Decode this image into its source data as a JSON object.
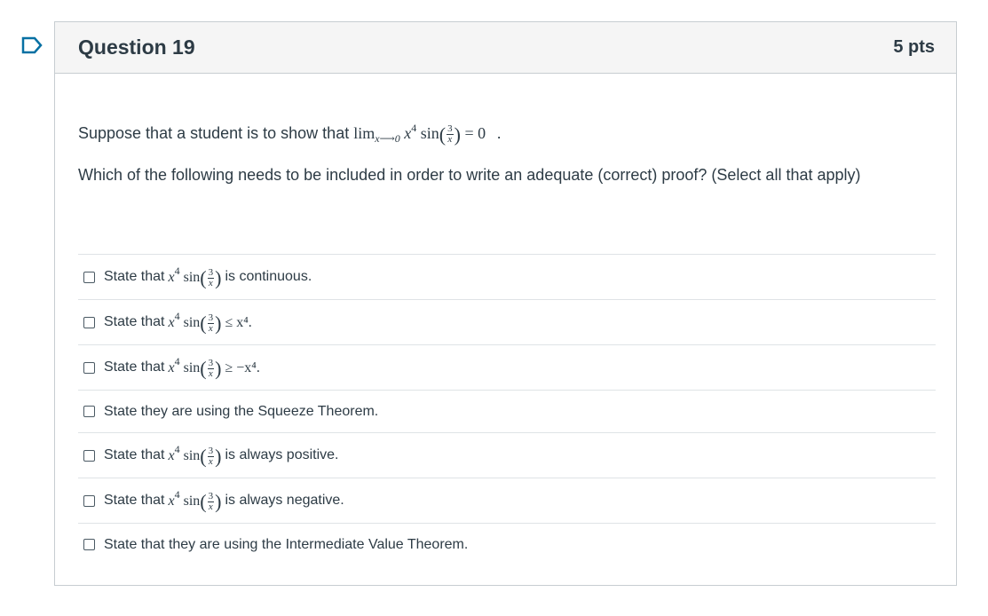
{
  "question": {
    "title": "Question 19",
    "points": "5 pts",
    "prompt_prefix": "Suppose that a student is to show that",
    "prompt_math": {
      "lim": "lim",
      "lim_sub": "x⟶0",
      "func_var": "x",
      "func_exp": "4",
      "func_sin": "sin",
      "frac_num": "3",
      "frac_den": "x",
      "equals": "= 0"
    },
    "prompt_suffix": ".",
    "instructions": "Which of the following needs to be included in order to write an adequate (correct) proof? (Select all that apply)"
  },
  "answers": [
    {
      "prefix": "State that",
      "expr_tail": "",
      "suffix": "is continuous."
    },
    {
      "prefix": "State that",
      "expr_tail": "≤ x⁴.",
      "suffix": ""
    },
    {
      "prefix": "State that",
      "expr_tail": "≥ −x⁴.",
      "suffix": ""
    },
    {
      "prefix": "State they are using the Squeeze Theorem.",
      "expr_tail": "",
      "suffix": ""
    },
    {
      "prefix": "State that",
      "expr_tail": "",
      "suffix": "is always positive."
    },
    {
      "prefix": "State that",
      "expr_tail": "",
      "suffix": "is always negative."
    },
    {
      "prefix": "State that they are using the Intermediate Value Theorem.",
      "expr_tail": "",
      "suffix": ""
    }
  ],
  "math_common": {
    "var": "x",
    "exp": "4",
    "sin": "sin",
    "num": "3",
    "den": "x"
  }
}
